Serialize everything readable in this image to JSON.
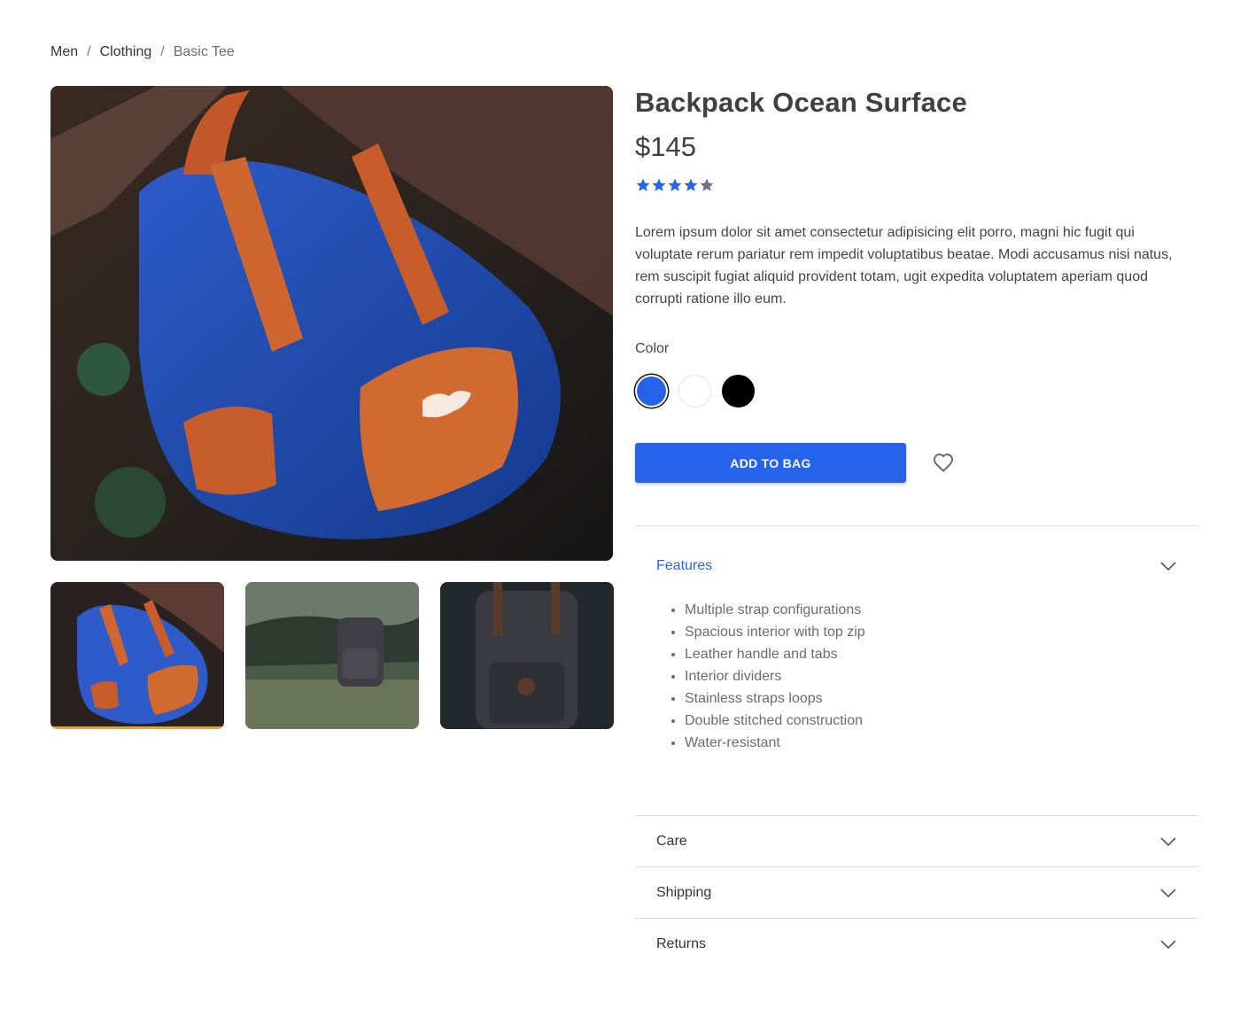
{
  "breadcrumb": {
    "items": [
      "Men",
      "Clothing",
      "Basic Tee"
    ],
    "separator": "/"
  },
  "product": {
    "title": "Backpack Ocean Surface",
    "price": "$145",
    "rating": 4,
    "rating_max": 5,
    "description": "Lorem ipsum dolor sit amet consectetur adipisicing elit porro, magni hic fugit qui voluptate rerum pariatur rem impedit voluptatibus beatae. Modi accusamus nisi natus, rem suscipit fugiat aliquid provident totam, ugit expedita voluptatem aperiam quod corrupti ratione illo eum."
  },
  "gallery": {
    "selected_index": 0,
    "images": [
      "blue-backpack-on-log",
      "gray-backpack-in-field",
      "gray-backpack-closeup"
    ]
  },
  "color": {
    "label": "Color",
    "options": [
      {
        "name": "blue",
        "hex": "#2563eb",
        "selected": true
      },
      {
        "name": "white",
        "hex": "#ffffff",
        "selected": false
      },
      {
        "name": "black",
        "hex": "#000000",
        "selected": false
      }
    ]
  },
  "actions": {
    "add_to_bag": "ADD TO BAG",
    "wishlist_icon": "heart-icon"
  },
  "accordion": {
    "sections": [
      {
        "title": "Features",
        "open": true,
        "items": [
          "Multiple strap configurations",
          "Spacious interior with top zip",
          "Leather handle and tabs",
          "Interior dividers",
          "Stainless straps loops",
          "Double stitched construction",
          "Water-resistant"
        ]
      },
      {
        "title": "Care",
        "open": false
      },
      {
        "title": "Shipping",
        "open": false
      },
      {
        "title": "Returns",
        "open": false
      }
    ]
  },
  "colors": {
    "accent": "#2563eb",
    "star_filled": "#2563eb",
    "star_empty": "#6b7280",
    "thumb_selected_bar": "#e0a63a"
  }
}
